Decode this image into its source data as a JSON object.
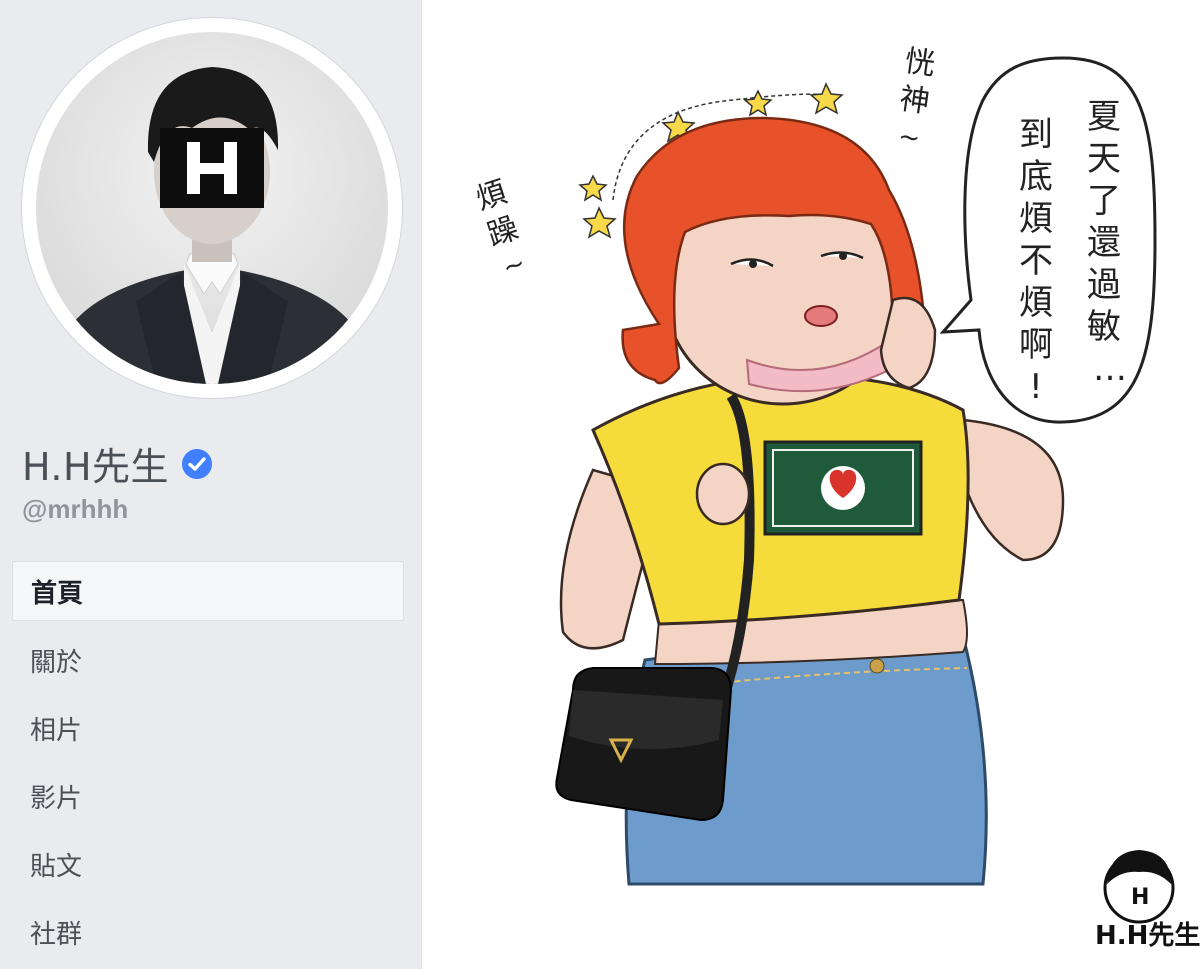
{
  "page": {
    "name": "H.H先生",
    "handle": "@mrhhh",
    "verified": true
  },
  "nav": {
    "items": [
      {
        "label": "首頁",
        "active": true
      },
      {
        "label": "關於",
        "active": false
      },
      {
        "label": "相片",
        "active": false
      },
      {
        "label": "影片",
        "active": false
      },
      {
        "label": "貼文",
        "active": false
      },
      {
        "label": "社群",
        "active": false
      }
    ]
  },
  "illustration": {
    "speech_col1": [
      "夏",
      "天",
      "了",
      "還",
      "過",
      "敏",
      "…"
    ],
    "speech_col2": [
      "到",
      "底",
      "煩",
      "不",
      "煩",
      "啊",
      "!"
    ],
    "label_dazed": [
      "恍",
      "神",
      "~"
    ],
    "label_irritable": [
      "煩",
      "躁",
      "~"
    ],
    "watermark": "H.H先生",
    "logo_mark": "H"
  },
  "colors": {
    "verified_blue": "#4080ff",
    "hair": "#e8522a",
    "shirt": "#f5dc3a",
    "jeans": "#6d9ccc"
  }
}
